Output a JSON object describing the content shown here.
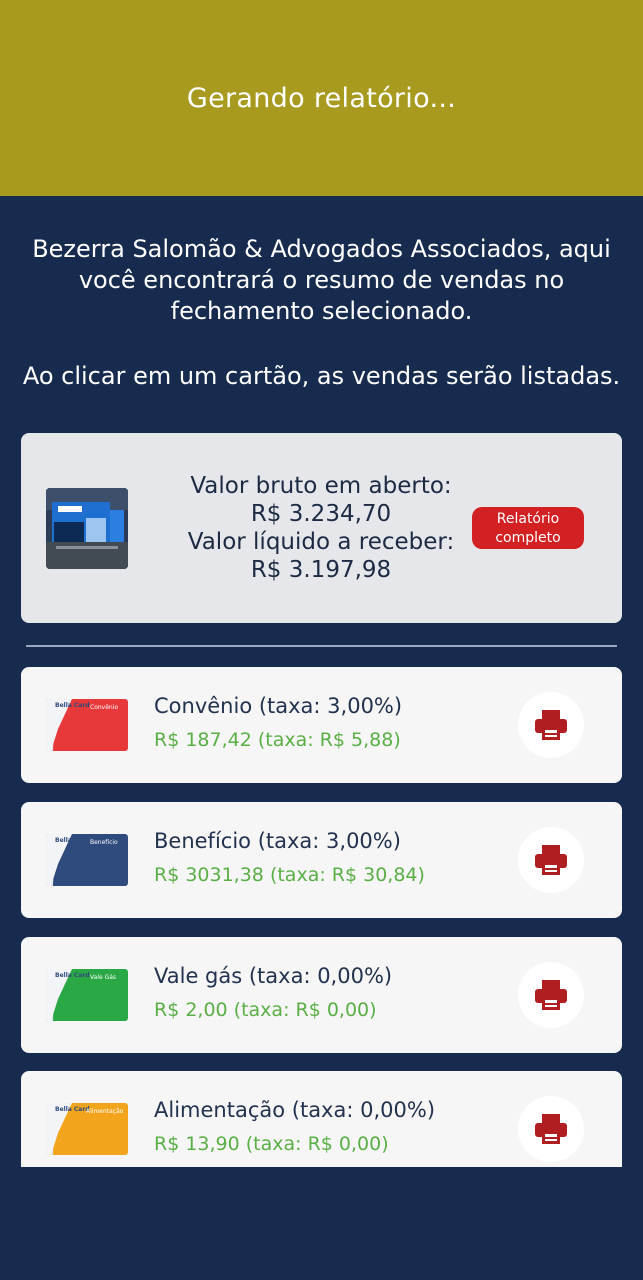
{
  "header": {
    "title": "Gerando relatório..."
  },
  "intro": {
    "message": "Bezerra Salomão & Advogados Associados, aqui você encontrará o resumo de vendas no fechamento selecionado.",
    "hint": "Ao clicar em um cartão, as vendas serão listadas."
  },
  "summary": {
    "gross_label": "Valor bruto em aberto:",
    "gross_value": "R$ 3.234,70",
    "net_label": "Valor líquido a receber:",
    "net_value": "R$ 3.197,98",
    "report_button": "Relatório completo"
  },
  "cards": [
    {
      "title": "Convênio (taxa: 3,00%)",
      "value": "R$ 187,42 (taxa: R$ 5,88)",
      "color": "#e8393a",
      "label": "Convênio"
    },
    {
      "title": "Benefício (taxa: 3,00%)",
      "value": "R$ 3031,38 (taxa: R$ 30,84)",
      "color": "#2f4a7c",
      "label": "Benefício"
    },
    {
      "title": "Vale gás (taxa: 0,00%)",
      "value": "R$ 2,00 (taxa: R$ 0,00)",
      "color": "#2aa845",
      "label": "Vale Gás"
    },
    {
      "title": "Alimentação (taxa: 0,00%)",
      "value": "R$ 13,90 (taxa: R$ 0,00)",
      "color": "#f2a41c",
      "label": "Alimentação"
    }
  ],
  "card_brand": "Bella Card",
  "icons": {
    "print": "printer-icon"
  },
  "colors": {
    "header": "#a89a1f",
    "background": "#172b4f",
    "accent_red": "#d32023",
    "value_green": "#5aaf46",
    "print_icon": "#b01e22"
  }
}
